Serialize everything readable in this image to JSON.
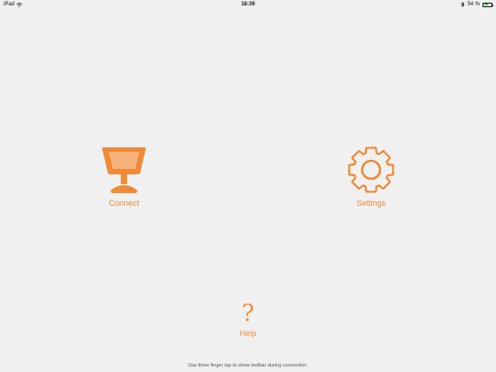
{
  "status_bar": {
    "device": "iPad",
    "time": "18:39",
    "battery_percent": "54 %",
    "battery_level": 0.54,
    "wifi_icon": "wifi-icon",
    "bluetooth_icon": "bluetooth-icon"
  },
  "actions": {
    "connect": {
      "label": "Connect",
      "icon": "presentation-podium-icon"
    },
    "settings": {
      "label": "Settings",
      "icon": "gear-icon"
    },
    "help": {
      "label": "Help",
      "icon": "question-mark-icon",
      "glyph": "?"
    }
  },
  "footer": {
    "hint": "Use three finger tap to show toolbar during connection."
  },
  "colors": {
    "accent": "#ef8a36",
    "background": "#f0f0f0",
    "battery": "#3fc24a"
  }
}
